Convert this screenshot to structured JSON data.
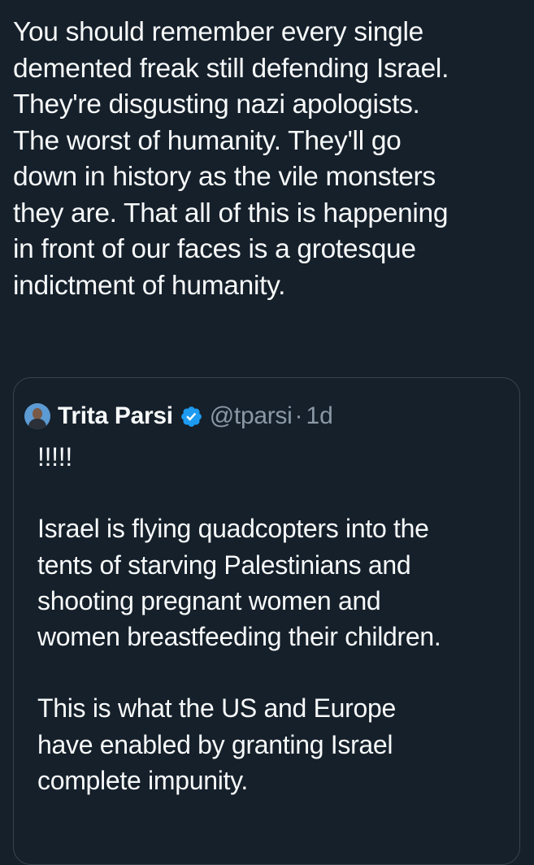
{
  "tweet": {
    "text": "You should remember every single demented freak still defending Israel. They're disgusting nazi apologists. The worst of humanity. They'll go down in history as the vile monsters they are. That all of this is happening in front of our faces is a grotesque indictment of humanity."
  },
  "quoted_tweet": {
    "author_name": "Trita Parsi",
    "verified": true,
    "handle": "@tparsi",
    "separator": "·",
    "time": "1d",
    "text": "!!!!!\n\nIsrael is flying quadcopters into the tents of starving Palestinians and shooting pregnant women and women breastfeeding their children.\n\nThis is what the US and Europe have enabled by granting Israel complete impunity."
  },
  "icons": {
    "avatar": "profile-photo",
    "verified": "verified-badge-icon"
  },
  "colors": {
    "background": "#15202b",
    "text_primary": "#f7f9f9",
    "text_secondary": "#8b98a5",
    "border": "#38444d",
    "verified_blue": "#1d9bf0"
  }
}
